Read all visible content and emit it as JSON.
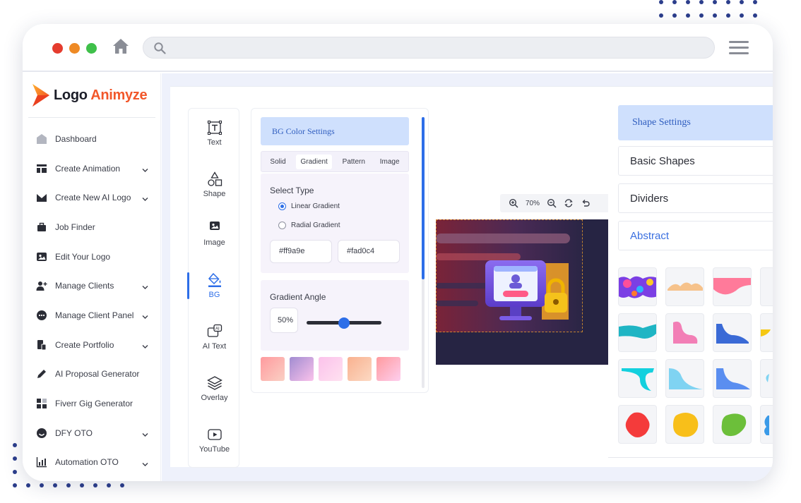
{
  "brand": {
    "name_part1": "Logo ",
    "name_part2": "Animyze",
    "accent": "#f2572a"
  },
  "sidebar": {
    "items": [
      {
        "label": "Dashboard",
        "icon": "dashboard-icon",
        "has_chevron": false
      },
      {
        "label": "Create Animation",
        "icon": "layout-icon",
        "has_chevron": true
      },
      {
        "label": "Create New AI Logo",
        "icon": "envelope-icon",
        "has_chevron": true
      },
      {
        "label": "Job Finder",
        "icon": "briefcase-icon",
        "has_chevron": false
      },
      {
        "label": "Edit Your Logo",
        "icon": "image-icon",
        "has_chevron": false
      },
      {
        "label": "Manage Clients",
        "icon": "user-plus-icon",
        "has_chevron": true
      },
      {
        "label": "Manage Client Panel",
        "icon": "chat-icon",
        "has_chevron": true
      },
      {
        "label": "Create Portfolio",
        "icon": "portfolio-icon",
        "has_chevron": true
      },
      {
        "label": "AI Proposal Generator",
        "icon": "pen-icon",
        "has_chevron": false
      },
      {
        "label": "Fiverr Gig Generator",
        "icon": "grid-icon",
        "has_chevron": false
      },
      {
        "label": "DFY OTO",
        "icon": "smile-icon",
        "has_chevron": true
      },
      {
        "label": "Automation OTO",
        "icon": "chart-icon",
        "has_chevron": true
      }
    ]
  },
  "tools": [
    {
      "label": "Text",
      "icon": "text-icon",
      "active": false
    },
    {
      "label": "Shape",
      "icon": "shape-icon",
      "active": false
    },
    {
      "label": "Image",
      "icon": "image-icon",
      "active": false
    },
    {
      "label": "BG",
      "icon": "paint-bucket-icon",
      "active": true
    },
    {
      "label": "AI Text",
      "icon": "ai-text-icon",
      "active": false
    },
    {
      "label": "Overlay",
      "icon": "layers-icon",
      "active": false
    },
    {
      "label": "YouTube",
      "icon": "youtube-icon",
      "active": false
    }
  ],
  "bg_panel": {
    "title": "BG Color Settings",
    "tabs": [
      "Solid",
      "Gradient",
      "Pattern",
      "Image"
    ],
    "active_tab": "Gradient",
    "select_type_label": "Select Type",
    "options": [
      "Linear Gradient",
      "Radial Gradient"
    ],
    "selected_option": "Linear Gradient",
    "color1": "#ff9a9e",
    "color2": "#fad0c4",
    "angle_label": "Gradient Angle",
    "angle_value": "50%",
    "angle_fraction": 0.5,
    "swatches": [
      [
        "#ff9a9e",
        "#fad0c4"
      ],
      [
        "#a18cd1",
        "#fbc2eb"
      ],
      [
        "#fbc2eb",
        "#ffe1f0"
      ],
      [
        "#f9b18f",
        "#fcd9c3"
      ],
      [
        "#ff9a9e",
        "#fecfef"
      ]
    ]
  },
  "zoom": {
    "value": "70%"
  },
  "shape_panel": {
    "title": "Shape Settings",
    "sections": [
      "Basic Shapes",
      "Dividers",
      "Abstract"
    ],
    "active_section": "Abstract"
  },
  "colors": {
    "primary": "#2d6ee8",
    "panel_header": "#cfe0fd",
    "preview_bg": "#262443"
  }
}
